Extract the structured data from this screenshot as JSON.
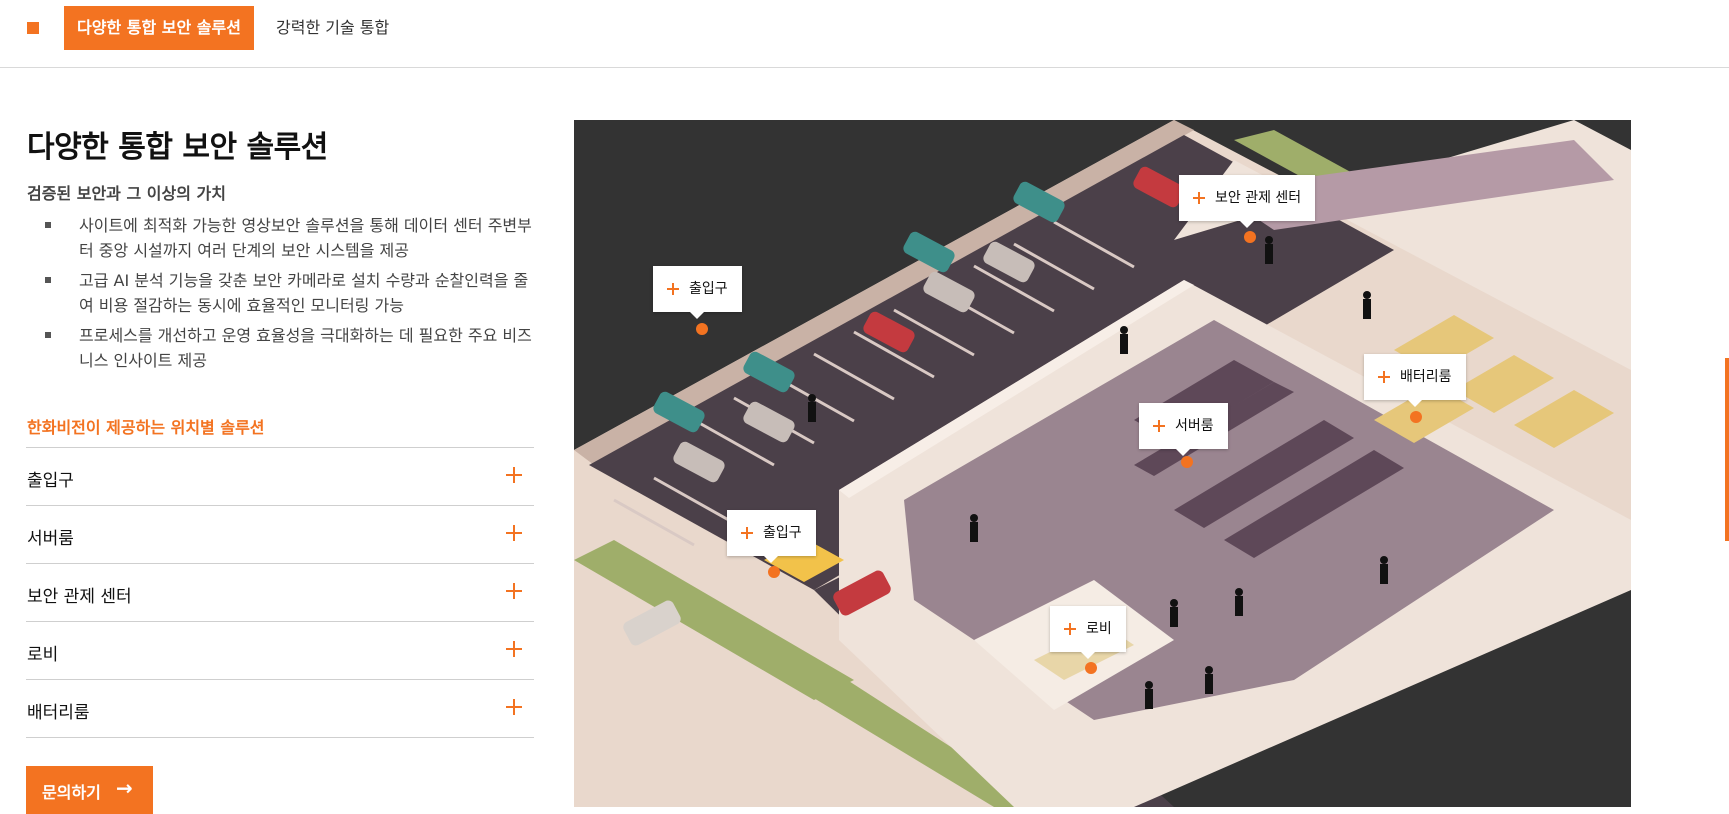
{
  "tabs": {
    "active_label": "다양한 통합 보안 솔루션",
    "second_label": "강력한 기술 통합"
  },
  "intro": {
    "title": "다양한 통합 보안 솔루션",
    "subtitle": "검증된 보안과 그 이상의 가치",
    "bullets": [
      "사이트에 최적화 가능한 영상보안 솔루션을 통해 데이터 센터 주변부터 중앙 시설까지 여러 단계의 보안 시스템을 제공",
      "고급 AI 분석 기능을 갖춘 보안 카메라로 설치 수량과 순찰인력을 줄여 비용 절감하는 동시에 효율적인 모니터링 가능",
      "프로세스를 개선하고 운영 효율성을 극대화하는 데 필요한 주요 비즈니스 인사이트 제공"
    ]
  },
  "locations": {
    "label": "한화비전이 제공하는 위치별 솔루션",
    "items": [
      {
        "label": "출입구"
      },
      {
        "label": "서버룸"
      },
      {
        "label": "보안 관제 센터"
      },
      {
        "label": "로비"
      },
      {
        "label": "배터리룸"
      }
    ]
  },
  "cta": {
    "label": "문의하기",
    "arrow": "→"
  },
  "illustration": {
    "pins": [
      {
        "label": "출입구"
      },
      {
        "label": "보안 관제 센터"
      },
      {
        "label": "배터리룸"
      },
      {
        "label": "서버룸"
      },
      {
        "label": "출입구"
      },
      {
        "label": "로비"
      }
    ]
  },
  "colors": {
    "accent": "#f37321",
    "text": "#111111",
    "muted_text": "#444444",
    "divider": "#cfcfcf",
    "scene_background": "#333333"
  },
  "icons": {
    "tab_marker": "orange-square-icon",
    "accordion_expand": "plus-icon",
    "cta_arrow": "arrow-right-icon",
    "pin": "plus-icon"
  }
}
